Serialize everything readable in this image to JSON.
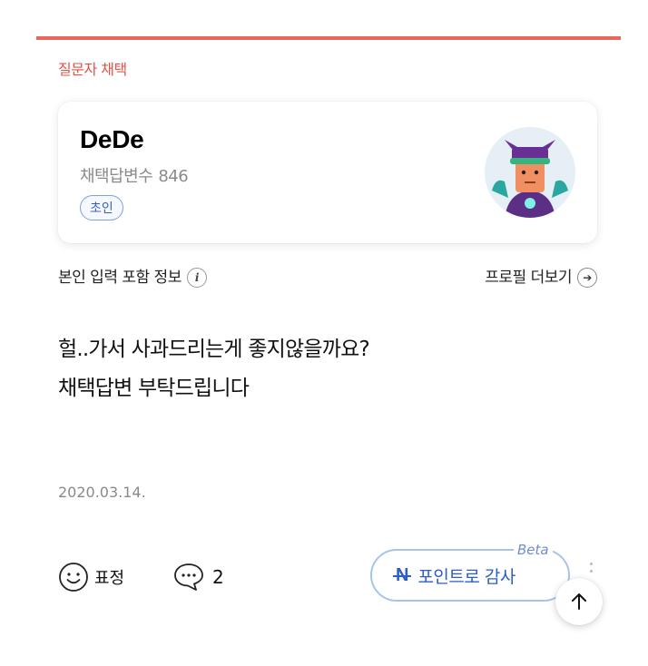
{
  "section": {
    "label": "질문자 채택"
  },
  "user": {
    "name": "DeDe",
    "stat_label": "채택답변수",
    "stat_value": "846",
    "rank": "초인",
    "avatar_icon": "avatar-character"
  },
  "profile_row": {
    "info_label": "본인 입력 포함 정보",
    "info_icon": "info-icon",
    "profile_link": "프로필 더보기",
    "profile_link_icon": "arrow-circle-right-icon"
  },
  "post": {
    "lines": [
      "헐..가서 사과드리는게 좋지않을까요?",
      "채택답변 부탁드립니다"
    ],
    "date": "2020.03.14."
  },
  "actions": {
    "reaction_label": "표정",
    "comment_count": "2",
    "point_button_label": "포인트로 감사",
    "point_button_icon": "N",
    "beta_tag": "Beta"
  },
  "colors": {
    "accent": "#e8675a",
    "rank_blue": "#3a63b8",
    "point_blue": "#2b5ec7"
  }
}
